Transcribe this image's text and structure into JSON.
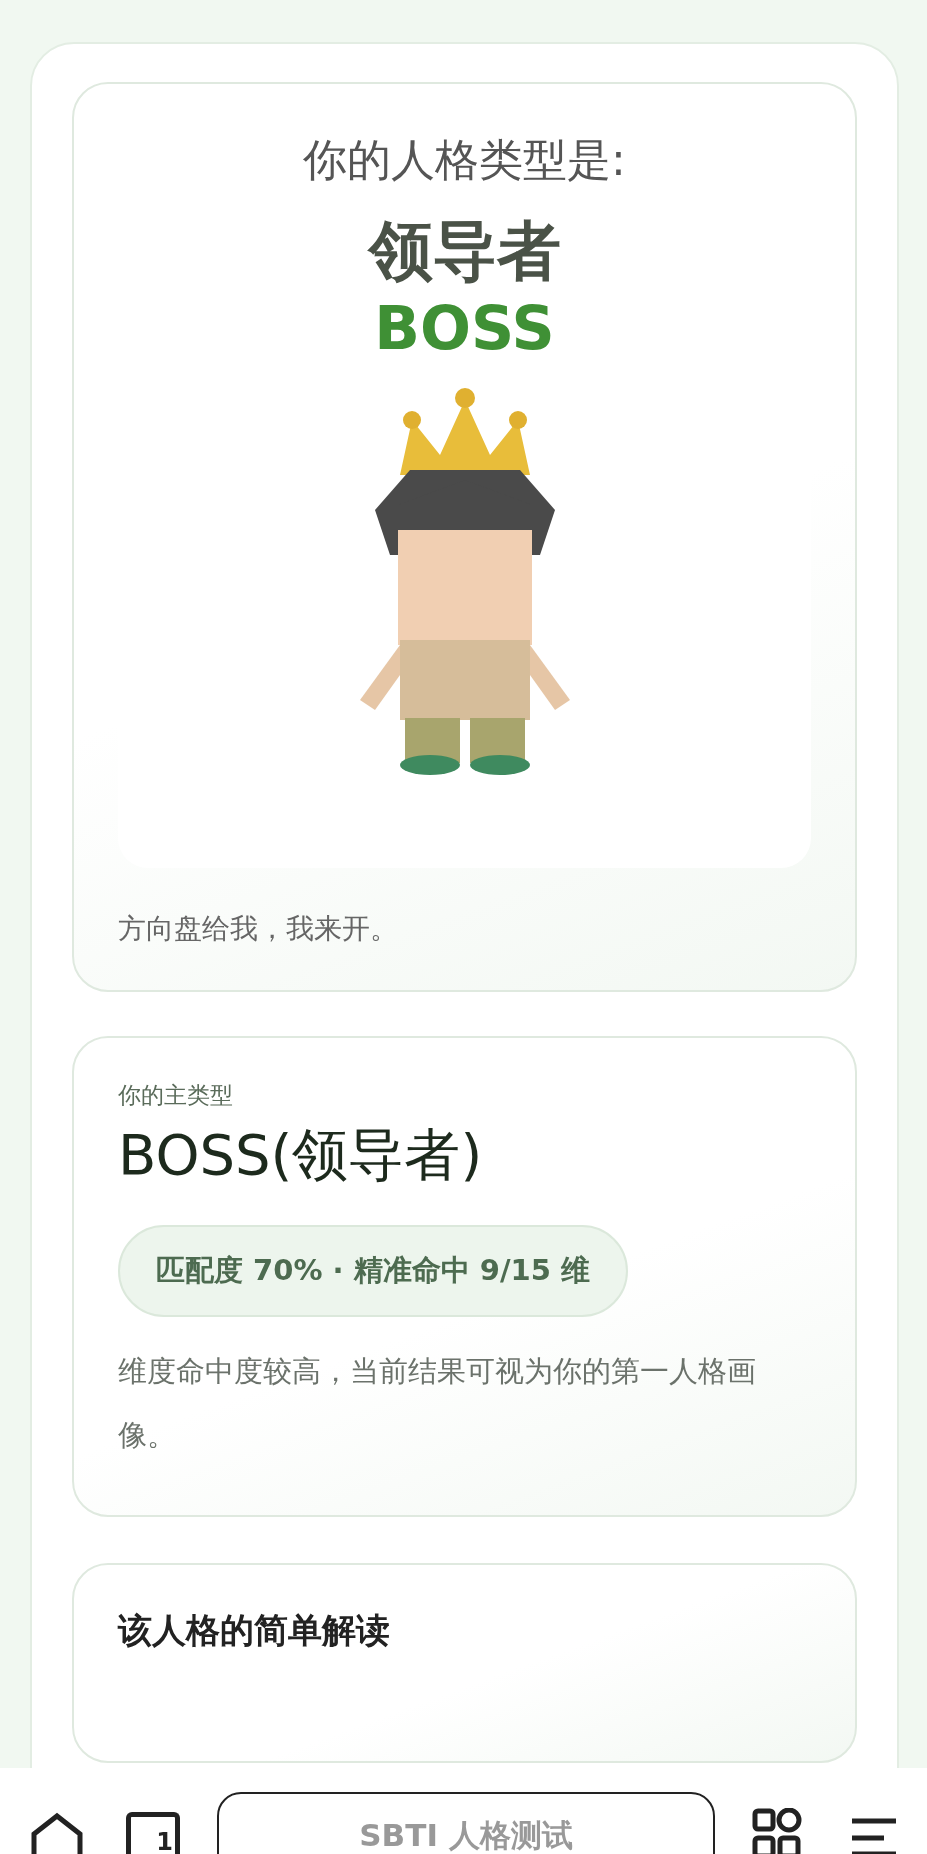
{
  "result_card": {
    "heading": "你的人格类型是:",
    "type_name": "领导者",
    "type_code": "BOSS",
    "quote": "方向盘给我，我来开。"
  },
  "main_type_card": {
    "label": "你的主类型",
    "title": "BOSS(领导者)",
    "match_badge": "匹配度 70% · 精准命中 9/15 维",
    "description": "维度命中度较高，当前结果可视为你的第一人格画像。"
  },
  "interpretation_card": {
    "title": "该人格的简单解读"
  },
  "bottom_bar": {
    "tab_count": "1",
    "address": "SBTI 人格测试"
  }
}
